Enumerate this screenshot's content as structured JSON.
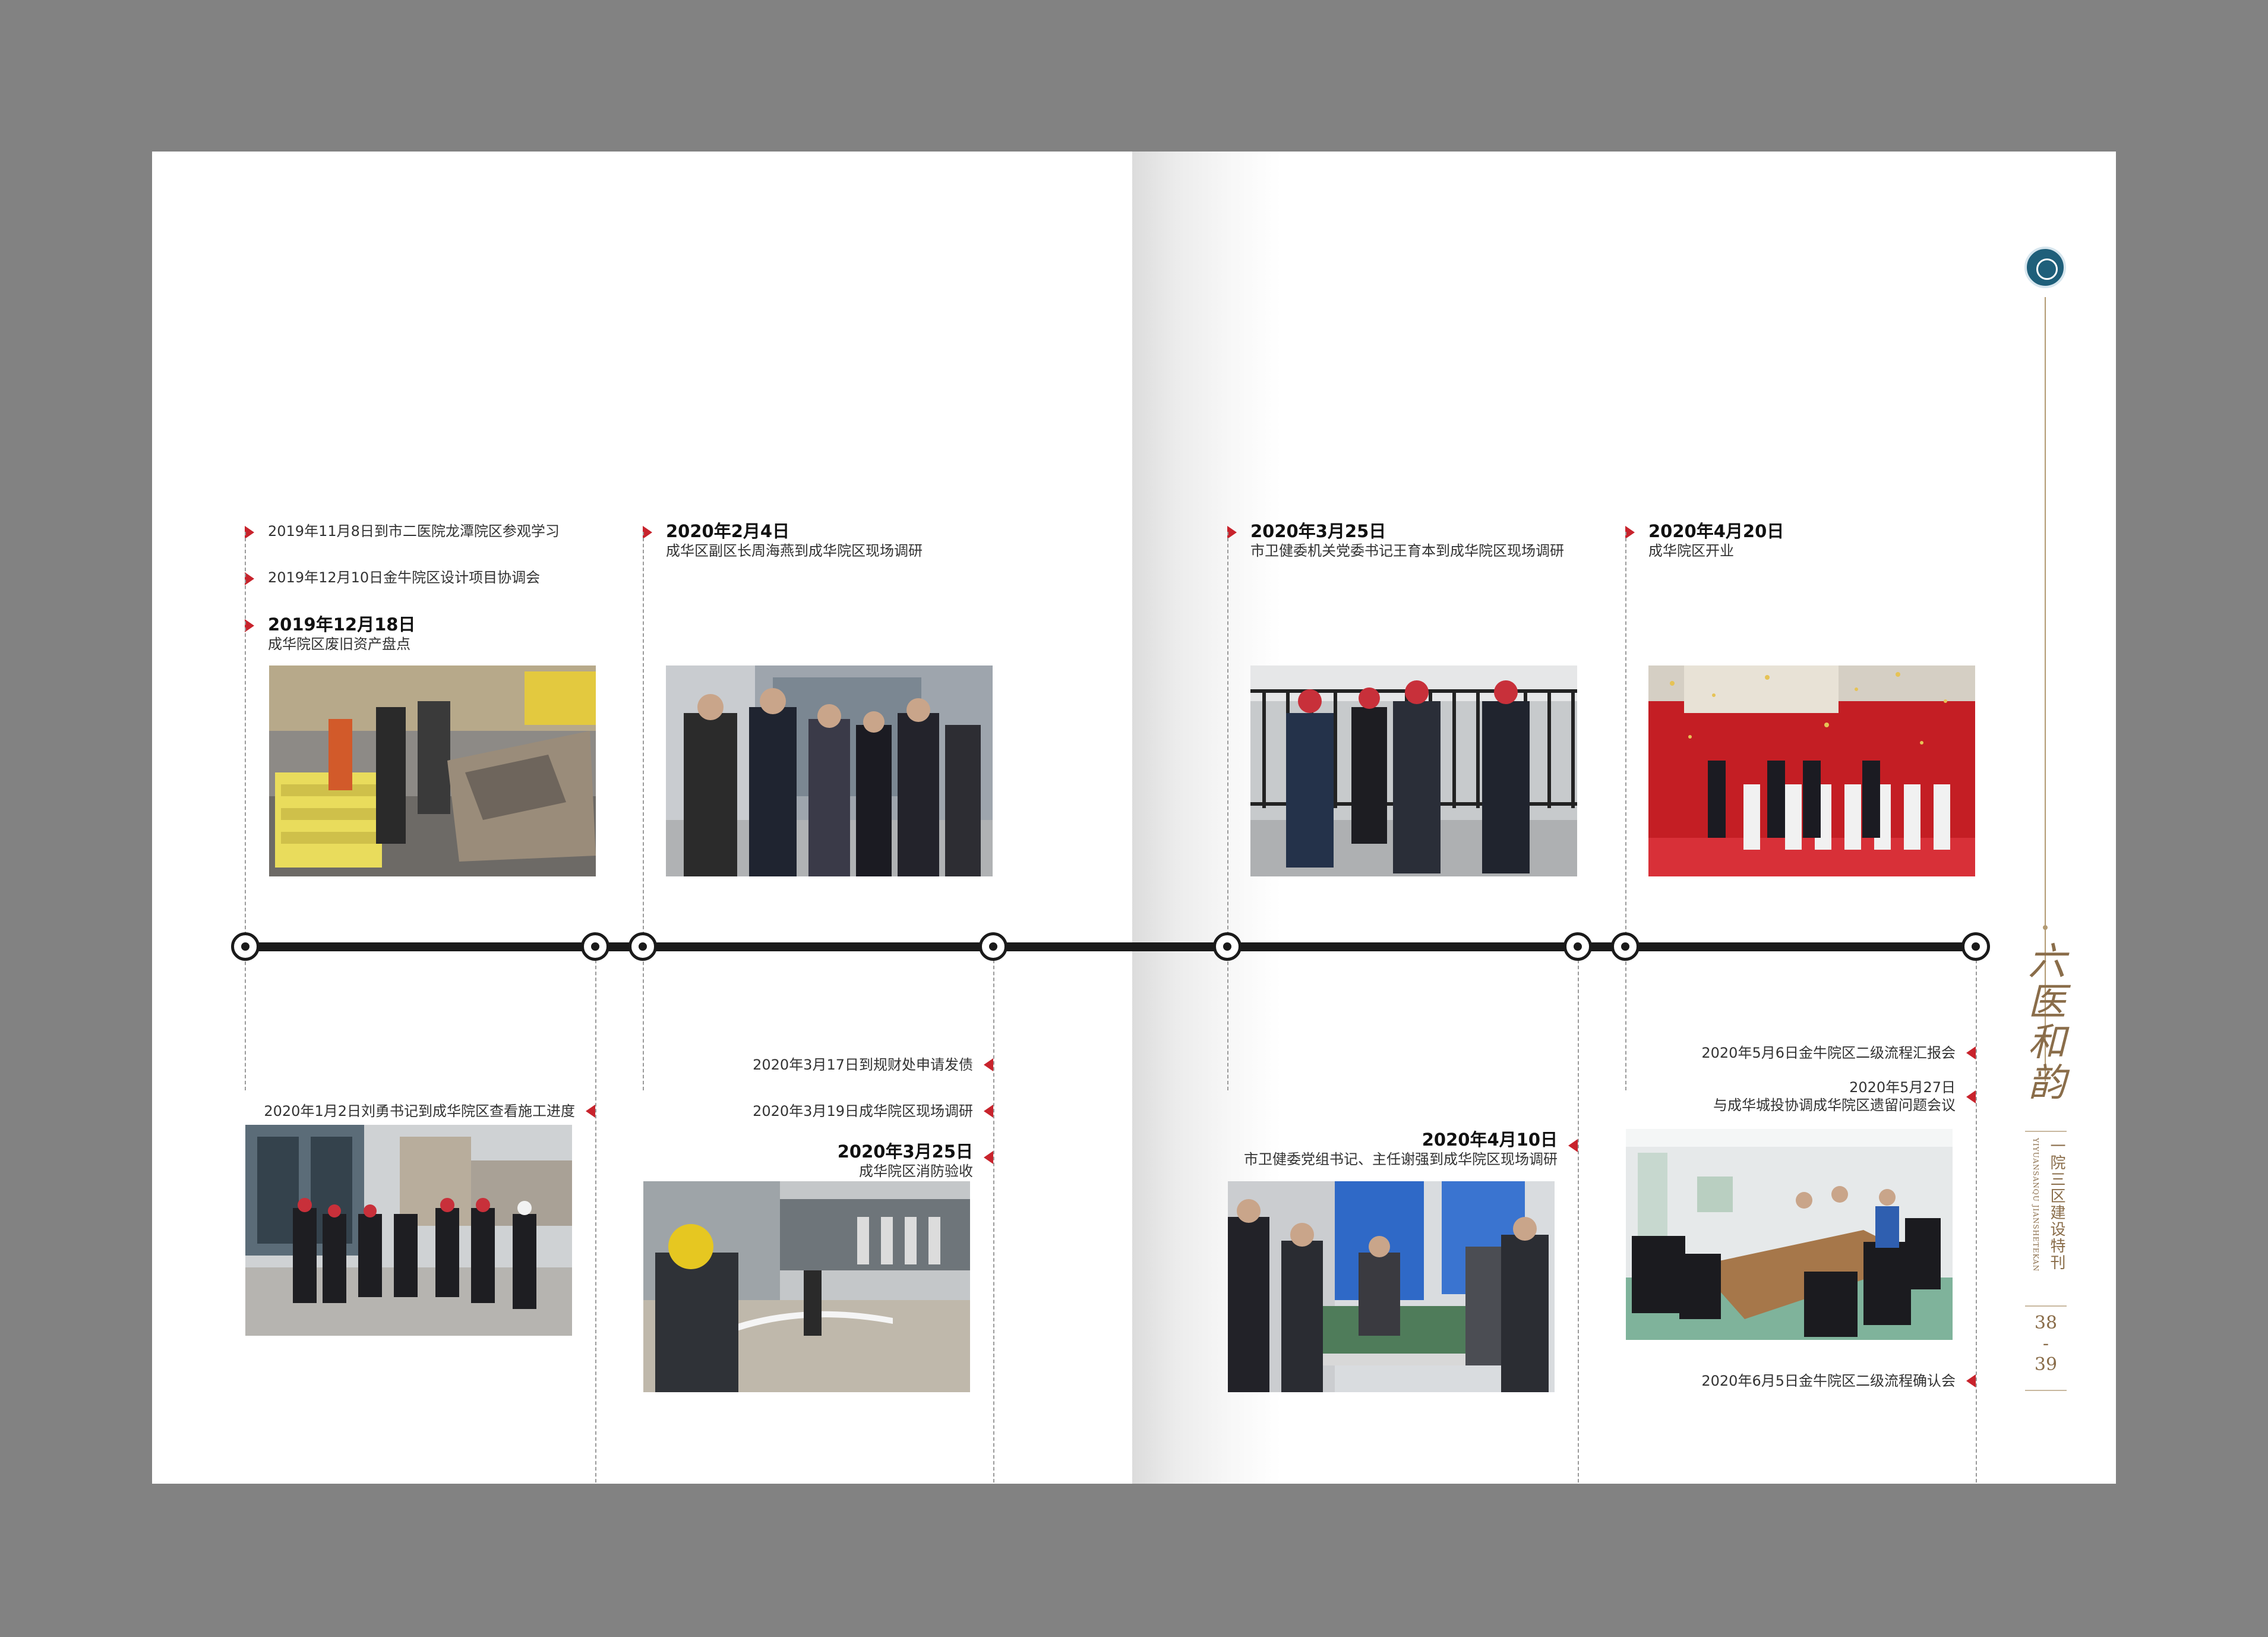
{
  "events_top": [
    {
      "id": "t1",
      "text": "2019年11月8日到市二医院龙潭院区参观学习"
    },
    {
      "id": "t2",
      "text": "2019年12月10日金牛院区设计项目协调会"
    },
    {
      "id": "t3",
      "date": "2019年12月18日",
      "text": "成华院区废旧资产盘点"
    },
    {
      "id": "t4",
      "date": "2020年2月4日",
      "text": "成华区副区长周海燕到成华院区现场调研"
    },
    {
      "id": "t5",
      "date": "2020年3月25日",
      "text": "市卫健委机关党委书记王育本到成华院区现场调研"
    },
    {
      "id": "t6",
      "date": "2020年4月20日",
      "text": "成华院区开业"
    }
  ],
  "events_bottom": [
    {
      "id": "b1",
      "text": "2020年1月2日刘勇书记到成华院区查看施工进度"
    },
    {
      "id": "b2",
      "text": "2020年3月17日到规财处申请发债"
    },
    {
      "id": "b3",
      "text": "2020年3月19日成华院区现场调研"
    },
    {
      "id": "b4",
      "date": "2020年3月25日",
      "text": "成华院区消防验收"
    },
    {
      "id": "b5",
      "date": "2020年4月10日",
      "text": "市卫健委党组书记、主任谢强到成华院区现场调研"
    },
    {
      "id": "b6",
      "text": "2020年5月6日金牛院区二级流程汇报会"
    },
    {
      "id": "b7",
      "date": "2020年5月27日",
      "text": "与成华城投协调成华院区遗留问题会议"
    },
    {
      "id": "b8",
      "text": "2020年6月5日金牛院区二级流程确认会"
    }
  ],
  "side": {
    "calligraphy": [
      "六",
      "医",
      "和",
      "韵"
    ],
    "vertical_title": "一院三区建设特刊",
    "vertical_pinyin": "YIYUANSANQU JIANSHETEKAN",
    "page_left": "38",
    "page_sep": "-",
    "page_right": "39"
  },
  "colors": {
    "accent": "#c8232c",
    "timeline": "#1a1a1a",
    "gold": "#8a6d4a"
  }
}
